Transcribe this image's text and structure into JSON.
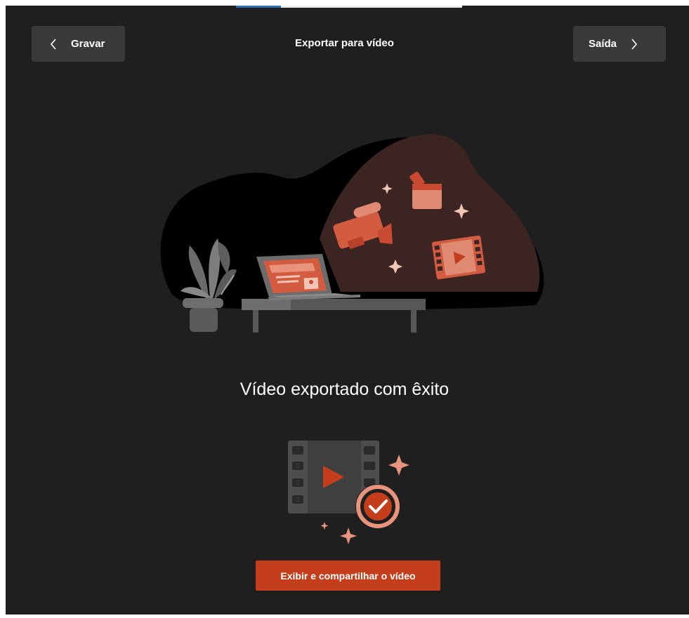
{
  "header": {
    "title": "Exportar para vídeo",
    "back_label": "Gravar",
    "exit_label": "Saída"
  },
  "main": {
    "success_message": "Vídeo exportado com êxito",
    "primary_action_label": "Exibir e compartilhar o vídeo"
  },
  "icons": {
    "back": "chevron-left-icon",
    "exit": "chevron-right-icon",
    "hero": "video-export-illustration",
    "result": "video-check-illustration"
  },
  "colors": {
    "background": "#1f1f1f",
    "button": "#3a3a3a",
    "accent": "#c43e1c",
    "illustration_orange": "#d85f45",
    "illustration_peach": "#e9937c"
  }
}
